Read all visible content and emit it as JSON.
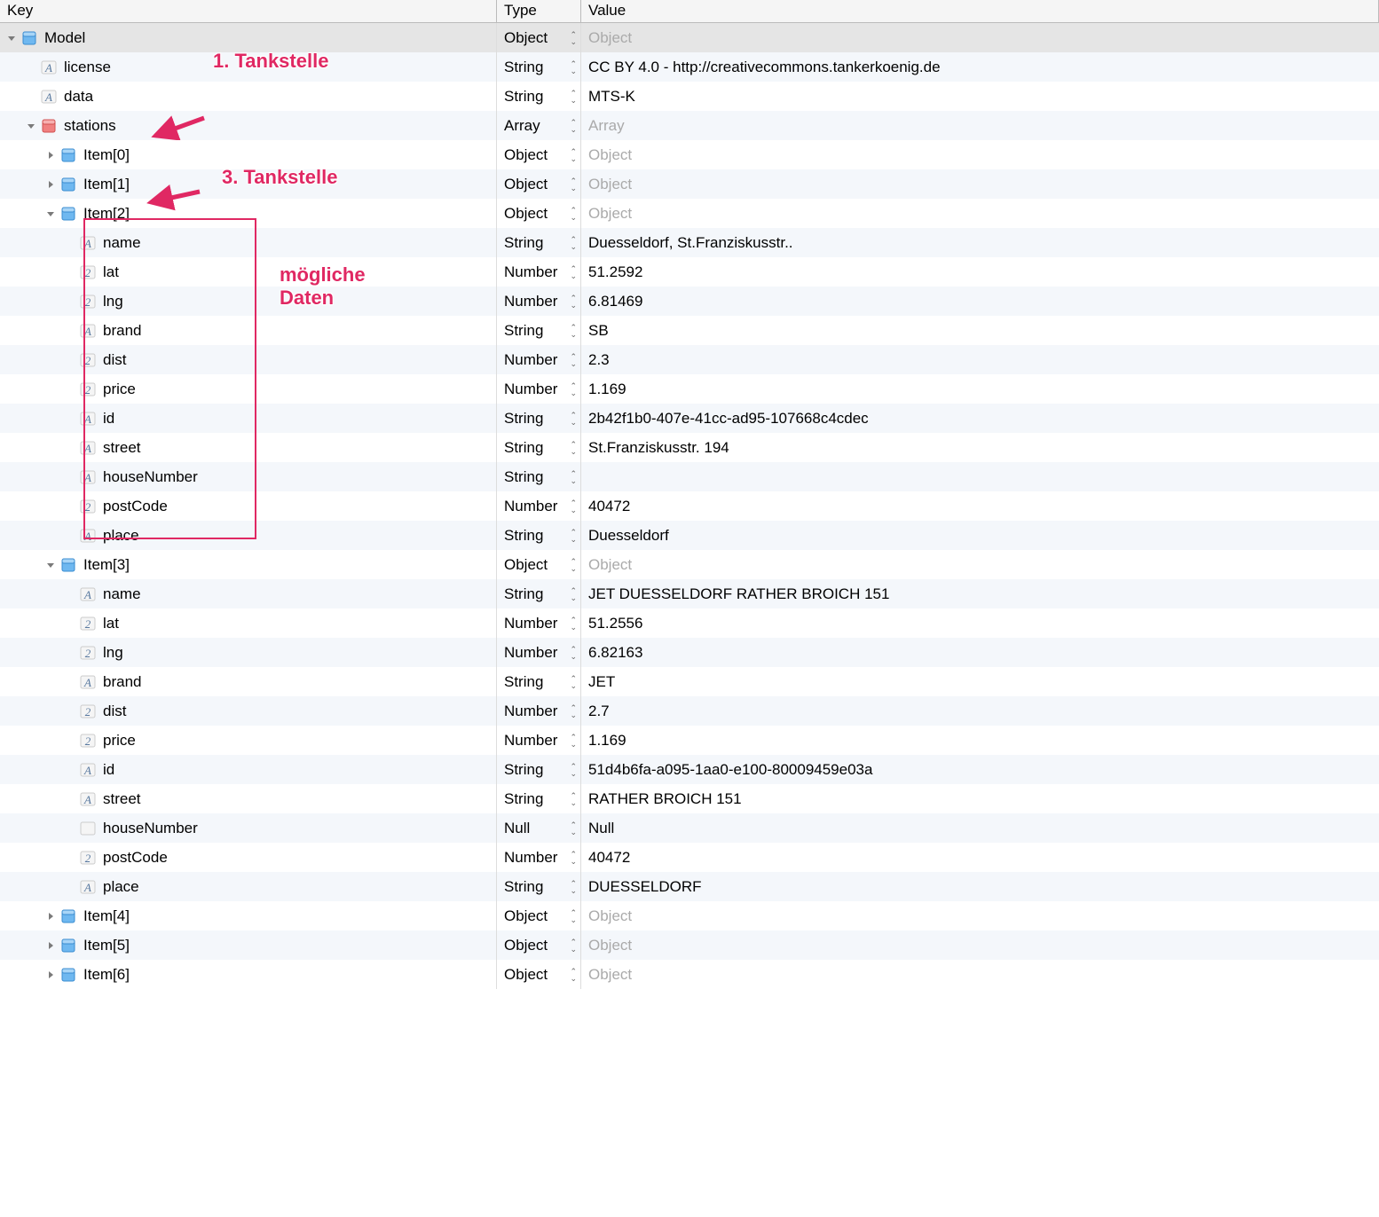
{
  "header": {
    "key": "Key",
    "type": "Type",
    "value": "Value"
  },
  "annotations": {
    "a1": "1. Tankstelle",
    "a2": "3. Tankstelle",
    "a3_line1": "mögliche",
    "a3_line2": "Daten"
  },
  "rows": [
    {
      "indent": 0,
      "tri": "down",
      "icon": "obj",
      "key": "Model",
      "type": "Object",
      "value": "Object",
      "ph": true
    },
    {
      "indent": 1,
      "tri": "",
      "icon": "str",
      "key": "license",
      "type": "String",
      "value": "CC BY 4.0 -  http://creativecommons.tankerkoenig.de"
    },
    {
      "indent": 1,
      "tri": "",
      "icon": "str",
      "key": "data",
      "type": "String",
      "value": "MTS-K"
    },
    {
      "indent": 1,
      "tri": "down",
      "icon": "arr",
      "key": "stations",
      "type": "Array",
      "value": "Array",
      "ph": true
    },
    {
      "indent": 2,
      "tri": "right",
      "icon": "obj",
      "key": "Item[0]",
      "type": "Object",
      "value": "Object",
      "ph": true
    },
    {
      "indent": 2,
      "tri": "right",
      "icon": "obj",
      "key": "Item[1]",
      "type": "Object",
      "value": "Object",
      "ph": true
    },
    {
      "indent": 2,
      "tri": "down",
      "icon": "obj",
      "key": "Item[2]",
      "type": "Object",
      "value": "Object",
      "ph": true
    },
    {
      "indent": 3,
      "tri": "",
      "icon": "str",
      "key": "name",
      "type": "String",
      "value": "Duesseldorf, St.Franziskusstr.."
    },
    {
      "indent": 3,
      "tri": "",
      "icon": "num",
      "key": "lat",
      "type": "Number",
      "value": "51.2592"
    },
    {
      "indent": 3,
      "tri": "",
      "icon": "num",
      "key": "lng",
      "type": "Number",
      "value": "6.81469"
    },
    {
      "indent": 3,
      "tri": "",
      "icon": "str",
      "key": "brand",
      "type": "String",
      "value": "SB"
    },
    {
      "indent": 3,
      "tri": "",
      "icon": "num",
      "key": "dist",
      "type": "Number",
      "value": "2.3"
    },
    {
      "indent": 3,
      "tri": "",
      "icon": "num",
      "key": "price",
      "type": "Number",
      "value": "1.169"
    },
    {
      "indent": 3,
      "tri": "",
      "icon": "str",
      "key": "id",
      "type": "String",
      "value": "2b42f1b0-407e-41cc-ad95-107668c4cdec"
    },
    {
      "indent": 3,
      "tri": "",
      "icon": "str",
      "key": "street",
      "type": "String",
      "value": "St.Franziskusstr. 194"
    },
    {
      "indent": 3,
      "tri": "",
      "icon": "str",
      "key": "houseNumber",
      "type": "String",
      "value": ""
    },
    {
      "indent": 3,
      "tri": "",
      "icon": "num",
      "key": "postCode",
      "type": "Number",
      "value": "40472"
    },
    {
      "indent": 3,
      "tri": "",
      "icon": "str",
      "key": "place",
      "type": "String",
      "value": "Duesseldorf"
    },
    {
      "indent": 2,
      "tri": "down",
      "icon": "obj",
      "key": "Item[3]",
      "type": "Object",
      "value": "Object",
      "ph": true
    },
    {
      "indent": 3,
      "tri": "",
      "icon": "str",
      "key": "name",
      "type": "String",
      "value": "JET DUESSELDORF RATHER BROICH 151"
    },
    {
      "indent": 3,
      "tri": "",
      "icon": "num",
      "key": "lat",
      "type": "Number",
      "value": "51.2556"
    },
    {
      "indent": 3,
      "tri": "",
      "icon": "num",
      "key": "lng",
      "type": "Number",
      "value": "6.82163"
    },
    {
      "indent": 3,
      "tri": "",
      "icon": "str",
      "key": "brand",
      "type": "String",
      "value": "JET"
    },
    {
      "indent": 3,
      "tri": "",
      "icon": "num",
      "key": "dist",
      "type": "Number",
      "value": "2.7"
    },
    {
      "indent": 3,
      "tri": "",
      "icon": "num",
      "key": "price",
      "type": "Number",
      "value": "1.169"
    },
    {
      "indent": 3,
      "tri": "",
      "icon": "str",
      "key": "id",
      "type": "String",
      "value": "51d4b6fa-a095-1aa0-e100-80009459e03a"
    },
    {
      "indent": 3,
      "tri": "",
      "icon": "str",
      "key": "street",
      "type": "String",
      "value": "RATHER BROICH 151"
    },
    {
      "indent": 3,
      "tri": "",
      "icon": "null",
      "key": "houseNumber",
      "type": "Null",
      "value": "Null"
    },
    {
      "indent": 3,
      "tri": "",
      "icon": "num",
      "key": "postCode",
      "type": "Number",
      "value": "40472"
    },
    {
      "indent": 3,
      "tri": "",
      "icon": "str",
      "key": "place",
      "type": "String",
      "value": "DUESSELDORF"
    },
    {
      "indent": 2,
      "tri": "right",
      "icon": "obj",
      "key": "Item[4]",
      "type": "Object",
      "value": "Object",
      "ph": true
    },
    {
      "indent": 2,
      "tri": "right",
      "icon": "obj",
      "key": "Item[5]",
      "type": "Object",
      "value": "Object",
      "ph": true
    },
    {
      "indent": 2,
      "tri": "right",
      "icon": "obj",
      "key": "Item[6]",
      "type": "Object",
      "value": "Object",
      "ph": true
    }
  ]
}
